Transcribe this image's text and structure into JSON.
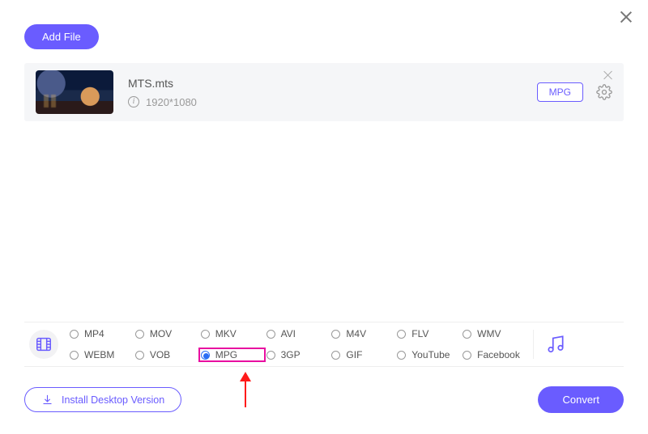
{
  "header": {
    "add_file_label": "Add File"
  },
  "file": {
    "name": "MTS.mts",
    "resolution": "1920*1080",
    "output_badge": "MPG"
  },
  "formats": {
    "row1": [
      "MP4",
      "MOV",
      "MKV",
      "AVI",
      "M4V",
      "FLV",
      "WMV"
    ],
    "row2": [
      "WEBM",
      "VOB",
      "MPG",
      "3GP",
      "GIF",
      "YouTube",
      "Facebook"
    ],
    "selected": "MPG"
  },
  "footer": {
    "install_label": "Install Desktop Version",
    "convert_label": "Convert"
  },
  "colors": {
    "accent": "#6a5cff",
    "highlight": "#e80ea0",
    "arrow": "#ff1a1a"
  }
}
